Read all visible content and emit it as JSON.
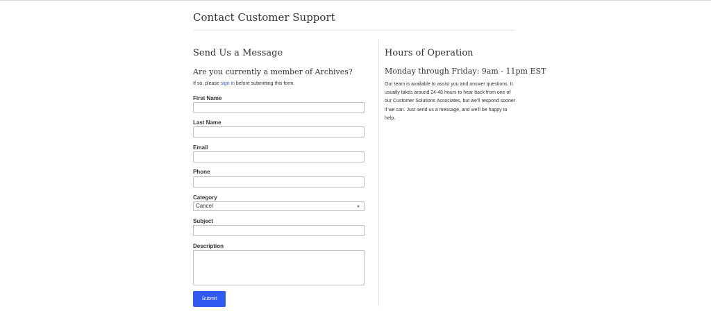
{
  "page": {
    "title": "Contact Customer Support"
  },
  "form": {
    "heading": "Send Us a Message",
    "member_question": "Are you currently a member of Archives?",
    "signin_prefix": "If so, please ",
    "signin_link": "sign in",
    "signin_suffix": " before submitting this form.",
    "fields": {
      "first_name": "First Name",
      "last_name": "Last Name",
      "email": "Email",
      "phone": "Phone",
      "category": "Category",
      "subject": "Subject",
      "description": "Description"
    },
    "category_value": "Cancel",
    "submit_label": "Submit"
  },
  "hours": {
    "heading": "Hours of Operation",
    "schedule": "Monday through Friday: 9am - 11pm EST",
    "body": "Our team is available to assist you and answer questions. It usually takes around 24-48 hours to hear back from one of our Customer Solutions Associates, but we'll respond sooner if we can. Just send us a message, and we'll be happy to help."
  },
  "colors": {
    "accent": "#2f5bf2",
    "link": "#2a5bd7"
  }
}
